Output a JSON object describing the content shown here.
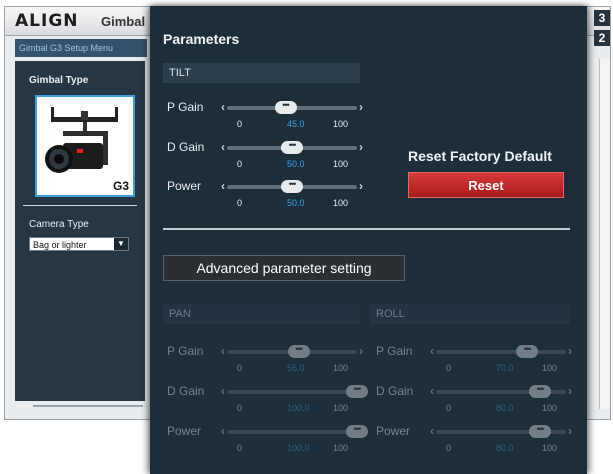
{
  "app": {
    "logo": "ALIGN",
    "window_title": "Gimbal",
    "setup_menu": "Gimbal G3 Setup Menu",
    "right_controls": [
      "3",
      "2"
    ]
  },
  "sidebar": {
    "gimbal_type_label": "Gimbal Type",
    "gimbal_badge": "G3",
    "camera_type_label": "Camera Type",
    "camera_selected": "Bag or lighter"
  },
  "panel": {
    "title": "Parameters",
    "tilt": {
      "header": "TILT",
      "sliders": [
        {
          "label": "P Gain",
          "min": "0",
          "value": "45.0",
          "max": "100",
          "fraction": 0.45
        },
        {
          "label": "D Gain",
          "min": "0",
          "value": "50.0",
          "max": "100",
          "fraction": 0.5
        },
        {
          "label": "Power",
          "min": "0",
          "value": "50.0",
          "max": "100",
          "fraction": 0.5
        }
      ]
    },
    "reset": {
      "title": "Reset Factory Default",
      "button": "Reset"
    },
    "advanced_button": "Advanced parameter setting",
    "pan": {
      "header": "PAN",
      "sliders": [
        {
          "label": "P Gain",
          "min": "0",
          "value": "55.0",
          "max": "100",
          "fraction": 0.55
        },
        {
          "label": "D Gain",
          "min": "0",
          "value": "100.0",
          "max": "100",
          "fraction": 1.0
        },
        {
          "label": "Power",
          "min": "0",
          "value": "100.0",
          "max": "100",
          "fraction": 1.0
        }
      ]
    },
    "roll": {
      "header": "ROLL",
      "sliders": [
        {
          "label": "P Gain",
          "min": "0",
          "value": "70.0",
          "max": "100",
          "fraction": 0.7
        },
        {
          "label": "D Gain",
          "min": "0",
          "value": "80.0",
          "max": "100",
          "fraction": 0.8
        },
        {
          "label": "Power",
          "min": "0",
          "value": "80.0",
          "max": "100",
          "fraction": 0.8
        }
      ]
    }
  }
}
